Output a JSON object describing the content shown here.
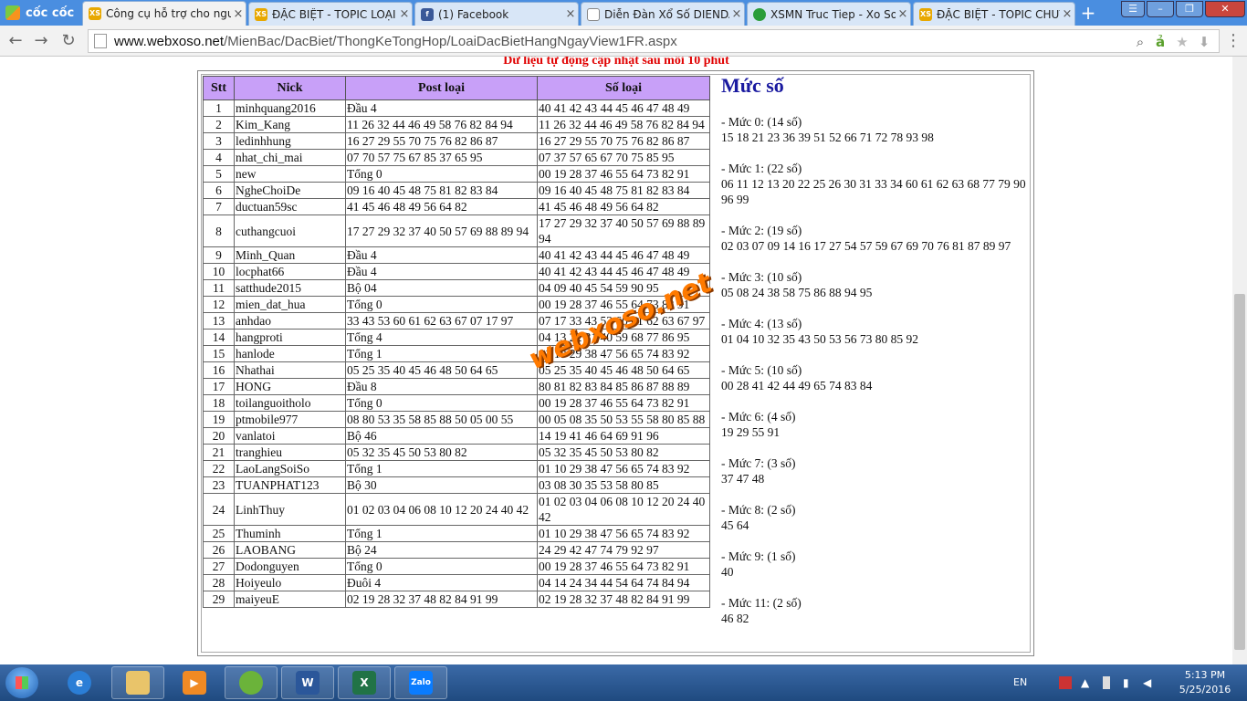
{
  "browser": {
    "brand": "cốc cốc",
    "tabs": [
      {
        "title": "Công cụ hỗ trợ cho người",
        "icon": "XS",
        "active": true
      },
      {
        "title": "ĐẶC BIỆT - TOPIC LOẠI Đ",
        "icon": "XS",
        "active": false
      },
      {
        "title": "(1) Facebook",
        "icon": "f",
        "active": false
      },
      {
        "title": "Diễn Đàn Xổ Số DIENDA",
        "icon": "doc",
        "active": false
      },
      {
        "title": "XSMN Truc Tiep - Xo So",
        "icon": "g",
        "active": false
      },
      {
        "title": "ĐẶC BIỆT - TOPIC CHUY",
        "icon": "XS",
        "active": false
      }
    ],
    "url_host": "www.webxoso.net",
    "url_path": "/MienBac/DacBiet/ThongKeTongHop/LoaiDacBietHangNgayView1FR.aspx"
  },
  "page": {
    "update_note": "Dữ liệu tự động cập nhật sau mỗi 10 phút",
    "watermark": "webxoso.net",
    "table": {
      "headers": [
        "Stt",
        "Nick",
        "Post loại",
        "Số loại"
      ],
      "rows": [
        [
          "1",
          "minhquang2016",
          "Đầu 4",
          "40 41 42 43 44 45 46 47 48 49"
        ],
        [
          "2",
          "Kim_Kang",
          "11 26 32 44 46 49 58 76 82 84 94",
          "11 26 32 44 46 49 58 76 82 84 94"
        ],
        [
          "3",
          "ledinhhung",
          "16 27 29 55 70 75 76 82 86 87",
          "16 27 29 55 70 75 76 82 86 87"
        ],
        [
          "4",
          "nhat_chi_mai",
          "07 70 57 75 67 85 37 65 95",
          "07 37 57 65 67 70 75 85 95"
        ],
        [
          "5",
          "new",
          "Tổng 0",
          "00 19 28 37 46 55 64 73 82 91"
        ],
        [
          "6",
          "NgheChoiDe",
          "09 16 40 45 48 75 81 82 83 84",
          "09 16 40 45 48 75 81 82 83 84"
        ],
        [
          "7",
          "ductuan59sc",
          "41 45 46 48 49 56 64 82",
          "41 45 46 48 49 56 64 82"
        ],
        [
          "8",
          "cuthangcuoi",
          "17 27 29 32 37 40 50 57 69 88 89 94",
          "17 27 29 32 37 40 50 57 69 88 89 94"
        ],
        [
          "9",
          "Minh_Quan",
          "Đầu 4",
          "40 41 42 43 44 45 46 47 48 49"
        ],
        [
          "10",
          "locphat66",
          "Đầu 4",
          "40 41 42 43 44 45 46 47 48 49"
        ],
        [
          "11",
          "satthude2015",
          "Bộ 04",
          "04 09 40 45 54 59 90 95"
        ],
        [
          "12",
          "mien_dat_hua",
          "Tổng 0",
          "00 19 28 37 46 55 64 73 82 91"
        ],
        [
          "13",
          "anhdao",
          "33 43 53 60 61 62 63 67 07 17 97",
          "07 17 33 43 53 60 61 62 63 67 97"
        ],
        [
          "14",
          "hangproti",
          "Tổng 4",
          "04 13 22 31 40 59 68 77 86 95"
        ],
        [
          "15",
          "hanlode",
          "Tổng 1",
          "01 10 29 38 47 56 65 74 83 92"
        ],
        [
          "16",
          "Nhathai",
          "05 25 35 40 45 46 48 50 64 65",
          "05 25 35 40 45 46 48 50 64 65"
        ],
        [
          "17",
          "HONG",
          "Đầu 8",
          "80 81 82 83 84 85 86 87 88 89"
        ],
        [
          "18",
          "toilanguoitholo",
          "Tổng 0",
          "00 19 28 37 46 55 64 73 82 91"
        ],
        [
          "19",
          "ptmobile977",
          "08 80 53 35 58 85 88 50 05 00 55",
          "00 05 08 35 50 53 55 58 80 85 88"
        ],
        [
          "20",
          "vanlatoi",
          "Bộ 46",
          "14 19 41 46 64 69 91 96"
        ],
        [
          "21",
          "tranghieu",
          "05 32 35 45 50 53 80 82",
          "05 32 35 45 50 53 80 82"
        ],
        [
          "22",
          "LaoLangSoiSo",
          "Tổng 1",
          "01 10 29 38 47 56 65 74 83 92"
        ],
        [
          "23",
          "TUANPHAT123",
          "Bộ 30",
          "03 08 30 35 53 58 80 85"
        ],
        [
          "24",
          "LinhThuy",
          "01 02 03 04 06 08 10 12 20 24 40 42",
          "01 02 03 04 06 08 10 12 20 24 40 42"
        ],
        [
          "25",
          "Thuminh",
          "Tổng 1",
          "01 10 29 38 47 56 65 74 83 92"
        ],
        [
          "26",
          "LAOBANG",
          "Bộ 24",
          "24 29 42 47 74 79 92 97"
        ],
        [
          "27",
          "Dodonguyen",
          "Tổng 0",
          "00 19 28 37 46 55 64 73 82 91"
        ],
        [
          "28",
          "Hoiyeulo",
          "Đuôi 4",
          "04 14 24 34 44 54 64 74 84 94"
        ],
        [
          "29",
          "maiyeuE",
          "02 19 28 32 37 48 82 84 91 99",
          "02 19 28 32 37 48 82 84 91 99"
        ]
      ]
    },
    "muc_so": {
      "title": "Mức số",
      "groups": [
        {
          "label": "- Mức 0: (14 số)",
          "numbers": "15 18 21 23 36 39 51 52 66 71 72 78 93 98"
        },
        {
          "label": "- Mức 1: (22 số)",
          "numbers": "06 11 12 13 20 22 25 26 30 31 33 34 60 61 62 63 68 77 79 90 96 99"
        },
        {
          "label": "- Mức 2: (19 số)",
          "numbers": "02 03 07 09 14 16 17 27 54 57 59 67 69 70 76 81 87 89 97"
        },
        {
          "label": "- Mức 3: (10 số)",
          "numbers": "05 08 24 38 58 75 86 88 94 95"
        },
        {
          "label": "- Mức 4: (13 số)",
          "numbers": "01 04 10 32 35 43 50 53 56 73 80 85 92"
        },
        {
          "label": "- Mức 5: (10 số)",
          "numbers": "00 28 41 42 44 49 65 74 83 84"
        },
        {
          "label": "- Mức 6: (4 số)",
          "numbers": "19 29 55 91"
        },
        {
          "label": "- Mức 7: (3 số)",
          "numbers": "37 47 48"
        },
        {
          "label": "- Mức 8: (2 số)",
          "numbers": "45 64"
        },
        {
          "label": "- Mức 9: (1 số)",
          "numbers": "40"
        },
        {
          "label": "- Mức 11: (2 số)",
          "numbers": "46 82"
        }
      ]
    }
  },
  "taskbar": {
    "apps": [
      "Internet Explorer",
      "File Explorer",
      "Media Player",
      "Cốc Cốc",
      "Word",
      "Excel",
      "Zalo"
    ],
    "language": "EN",
    "time": "5:13 PM",
    "date": "5/25/2016"
  },
  "colors": {
    "tabstrip": "#4a8ee0",
    "header_bg": "#c8a0f8",
    "note_red": "#e00000",
    "title_blue": "#1a1aa0",
    "watermark": "#ff7a00"
  }
}
